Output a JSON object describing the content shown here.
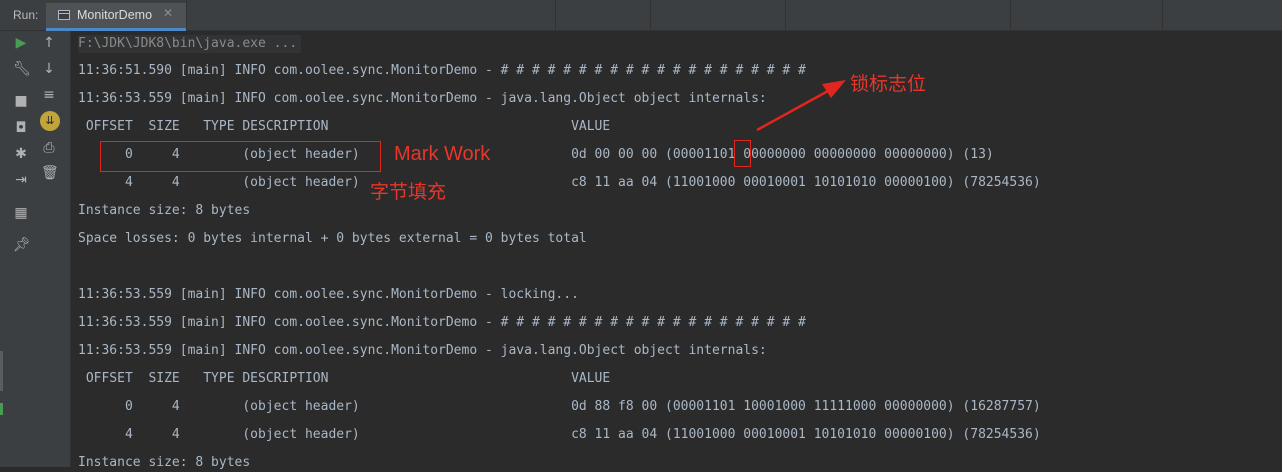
{
  "header": {
    "run_label": "Run:",
    "tab_title": "MonitorDemo",
    "tab_close": "✕"
  },
  "toolbar": {
    "icons": [
      "run-icon",
      "scroll-up-icon",
      "wrench-icon",
      "scroll-down-icon",
      "stop-icon",
      "soft-wrap-icon",
      "camera-icon",
      "scroll-to-end-icon",
      "debug-icon",
      "print-icon",
      "login-icon",
      "trash-icon",
      "layout-icon",
      "pin-icon"
    ]
  },
  "console": {
    "lines": [
      "F:\\JDK\\JDK8\\bin\\java.exe ...",
      "11:36:51.590 [main] INFO com.oolee.sync.MonitorDemo - # # # # # # # # # # # # # # # # # # # #",
      "11:36:53.559 [main] INFO com.oolee.sync.MonitorDemo - java.lang.Object object internals:",
      " OFFSET  SIZE   TYPE DESCRIPTION                               VALUE",
      "      0     4        (object header)                           0d 00 00 00 (00001101 00000000 00000000 00000000) (13)",
      "      4     4        (object header)                           c8 11 aa 04 (11001000 00010001 10101010 00000100) (78254536)",
      "Instance size: 8 bytes",
      "Space losses: 0 bytes internal + 0 bytes external = 0 bytes total",
      "",
      "11:36:53.559 [main] INFO com.oolee.sync.MonitorDemo - locking...",
      "11:36:53.559 [main] INFO com.oolee.sync.MonitorDemo - # # # # # # # # # # # # # # # # # # # #",
      "11:36:53.559 [main] INFO com.oolee.sync.MonitorDemo - java.lang.Object object internals:",
      " OFFSET  SIZE   TYPE DESCRIPTION                               VALUE",
      "      0     4        (object header)                           0d 88 f8 00 (00001101 10001000 11111000 00000000) (16287757)",
      "      4     4        (object header)                           c8 11 aa 04 (11001000 00010001 10101010 00000100) (78254536)",
      "Instance size: 8 bytes"
    ]
  },
  "annotations": {
    "mark_word": "Mark Work",
    "padding": "字节填充",
    "lock_flag": "锁标志位",
    "color": "#e2261e"
  }
}
